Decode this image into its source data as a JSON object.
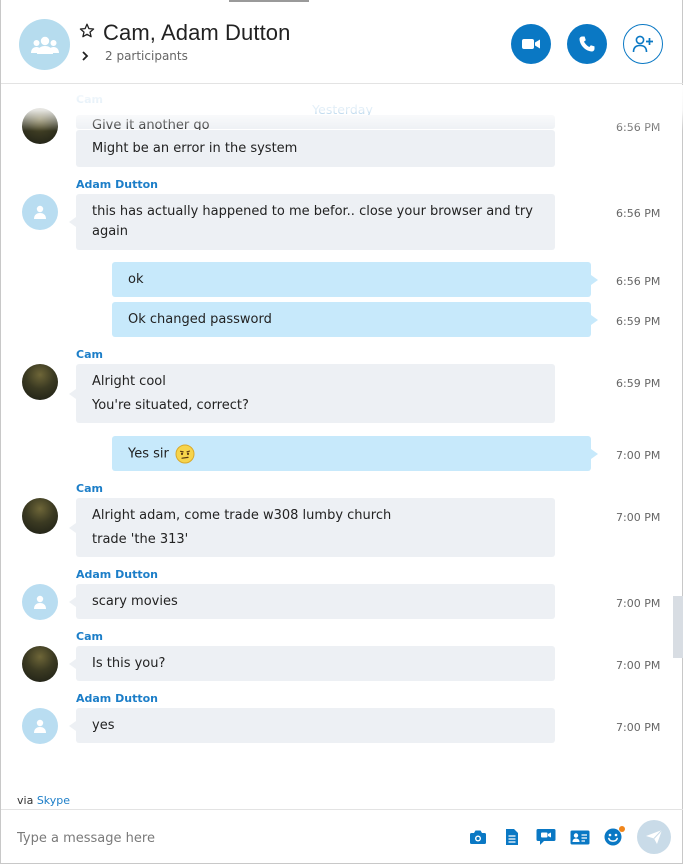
{
  "header": {
    "title": "Cam, Adam Dutton",
    "participants": "2 participants"
  },
  "conversation": {
    "day_divider": "Yesterday",
    "faded_sender": "Cam",
    "faded_message": "Give it another go",
    "faded_time": "6:56 PM",
    "messages": [
      {
        "sender": "Cam",
        "lines": [
          "Might be an error in the system"
        ]
      },
      {
        "sender": "Adam Dutton",
        "lines": [
          "this has actually happened to me befor.. close your browser and try",
          "again"
        ],
        "time": "6:56 PM"
      },
      {
        "sender": "me",
        "lines": [
          "ok"
        ],
        "time": "6:56 PM"
      },
      {
        "sender": "me",
        "lines": [
          "Ok changed password"
        ],
        "time": "6:59 PM"
      },
      {
        "sender": "Cam",
        "lines": [
          "Alright cool",
          "You're situated, correct?"
        ],
        "time": "6:59 PM"
      },
      {
        "sender": "me",
        "lines": [
          "Yes sir"
        ],
        "time": "7:00 PM",
        "emoji": "thinking-face"
      },
      {
        "sender": "Cam",
        "lines": [
          "Alright adam, come trade w308 lumby church",
          "trade 'the 313'"
        ],
        "time": "7:00 PM"
      },
      {
        "sender": "Adam Dutton",
        "lines": [
          "scary movies"
        ],
        "time": "7:00 PM"
      },
      {
        "sender": "Cam",
        "lines": [
          "Is this you?"
        ],
        "time": "7:00 PM"
      },
      {
        "sender": "Adam Dutton",
        "lines": [
          "yes"
        ],
        "time": "7:00 PM"
      }
    ]
  },
  "footer": {
    "via_prefix": "via",
    "via_link": "Skype",
    "input_placeholder": "Type a message here"
  },
  "icons": [
    "group-icon",
    "star-icon",
    "chevron-right-icon",
    "video-call-icon",
    "phone-icon",
    "add-person-icon",
    "person-icon",
    "media-icon",
    "file-icon",
    "video-message-icon",
    "contact-card-icon",
    "emoji-icon",
    "send-icon"
  ],
  "colors": {
    "accent": "#0a78c4",
    "link": "#1c7ec8",
    "incoming_bubble": "#edf0f4",
    "outgoing_bubble": "#c7e9fb",
    "avatar_default": "#b9ddf1"
  }
}
